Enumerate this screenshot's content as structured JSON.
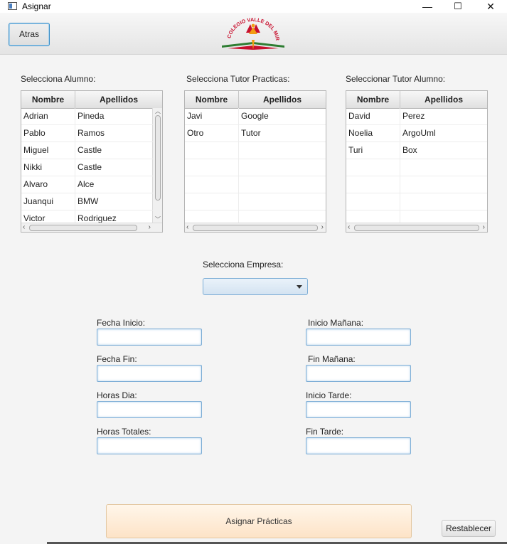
{
  "window": {
    "title": "Asignar",
    "controls": {
      "minimize": "—",
      "maximize": "☐",
      "close": "✕"
    }
  },
  "toolbar": {
    "back_label": "Atras"
  },
  "logo": {
    "text": "COLEGIO VALLE DEL MIRO",
    "colors": {
      "red": "#c8102e",
      "green": "#2e7d32",
      "orange": "#f39c12"
    }
  },
  "tables": {
    "alumno": {
      "label": "Selecciona Alumno:",
      "columns": [
        "Nombre",
        "Apellidos"
      ],
      "rows": [
        [
          "Adrian",
          "Pineda"
        ],
        [
          "Pablo",
          "Ramos"
        ],
        [
          "Miguel",
          "Castle"
        ],
        [
          "Nikki",
          "Castle"
        ],
        [
          "Alvaro",
          "Alce"
        ],
        [
          "Juanqui",
          "BMW"
        ],
        [
          "Victor",
          "Rodriguez"
        ]
      ]
    },
    "tutor_practicas": {
      "label": "Selecciona Tutor Practicas:",
      "columns": [
        "Nombre",
        "Apellidos"
      ],
      "rows": [
        [
          "Javi",
          "Google"
        ],
        [
          "Otro",
          "Tutor"
        ]
      ]
    },
    "tutor_alumno": {
      "label": "Seleccionar Tutor Alumno:",
      "columns": [
        "Nombre",
        "Apellidos"
      ],
      "rows": [
        [
          "David",
          "Perez"
        ],
        [
          "Noelia",
          "ArgoUml"
        ],
        [
          "Turi",
          "Box"
        ]
      ]
    }
  },
  "empresa": {
    "label": "Selecciona Empresa:",
    "selected": ""
  },
  "fields": {
    "fecha_inicio": {
      "label": "Fecha Inicio:",
      "value": ""
    },
    "fecha_fin": {
      "label": "Fecha Fin:",
      "value": ""
    },
    "horas_dia": {
      "label": "Horas Dia:",
      "value": ""
    },
    "horas_totales": {
      "label": "Horas Totales:",
      "value": ""
    },
    "inicio_manana": {
      "label": "Inicio Mañana:",
      "value": ""
    },
    "fin_manana": {
      "label": "Fin Mañana:",
      "value": ""
    },
    "inicio_tarde": {
      "label": "Inicio Tarde:",
      "value": ""
    },
    "fin_tarde": {
      "label": "Fin Tarde:",
      "value": ""
    }
  },
  "buttons": {
    "assign_label": "Asignar Prácticas",
    "reset_label": "Restablecer"
  }
}
